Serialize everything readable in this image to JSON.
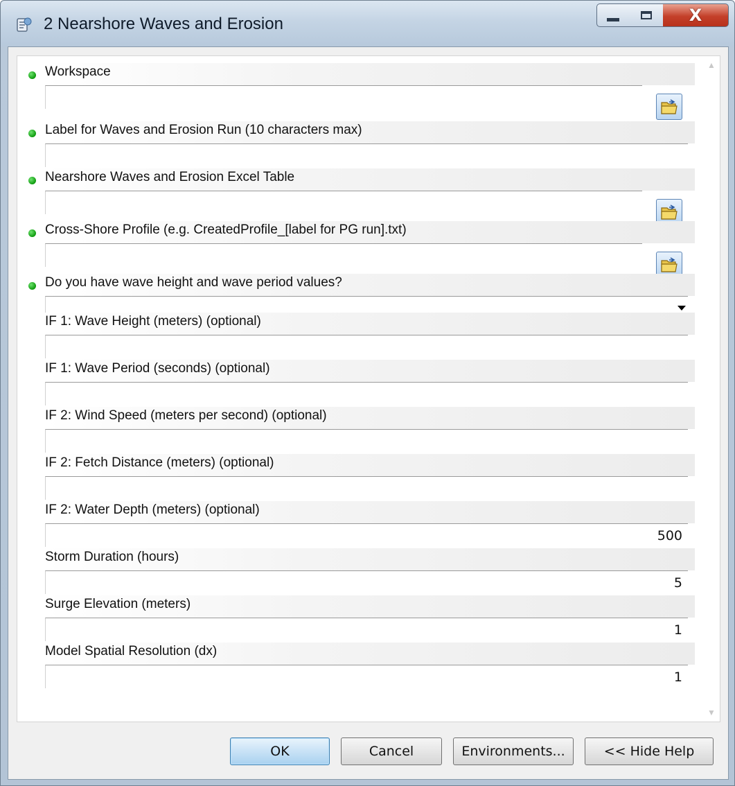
{
  "window": {
    "title": "2 Nearshore Waves and Erosion",
    "app_icon": "toolbox-script-icon",
    "controls": {
      "minimize": "—",
      "maximize": "☐",
      "close": "X"
    }
  },
  "params": [
    {
      "label": "Workspace",
      "required": true,
      "value": "",
      "browse": true
    },
    {
      "label": "Label for Waves and Erosion Run (10 characters max)",
      "required": true,
      "value": ""
    },
    {
      "label": "Nearshore Waves and Erosion Excel Table",
      "required": true,
      "value": "",
      "browse": true
    },
    {
      "label": "Cross-Shore Profile (e.g. CreatedProfile_[label for PG run].txt)",
      "required": true,
      "value": "",
      "browse": true
    },
    {
      "label": "Do you have wave height and wave period values?",
      "required": true,
      "value": "",
      "dropdown": true
    },
    {
      "label": "IF 1: Wave Height (meters) (optional)",
      "required": false,
      "value": ""
    },
    {
      "label": "IF 1: Wave Period (seconds) (optional)",
      "required": false,
      "value": ""
    },
    {
      "label": "IF 2: Wind Speed (meters per second) (optional)",
      "required": false,
      "value": ""
    },
    {
      "label": "IF 2: Fetch Distance (meters) (optional)",
      "required": false,
      "value": ""
    },
    {
      "label": "IF 2: Water Depth (meters) (optional)",
      "required": false,
      "value": "500"
    },
    {
      "label": "Storm Duration (hours)",
      "required": false,
      "value": "5"
    },
    {
      "label": "Surge Elevation (meters)",
      "required": false,
      "value": "1"
    },
    {
      "label": "Model Spatial Resolution (dx)",
      "required": false,
      "value": "1"
    }
  ],
  "buttons": {
    "ok": "OK",
    "cancel": "Cancel",
    "environments": "Environments...",
    "hide_help": "<< Hide Help"
  },
  "colors": {
    "required_dot": "#0d9a0d",
    "default_button": "#a9d1ef",
    "close_button": "#c4402a"
  }
}
